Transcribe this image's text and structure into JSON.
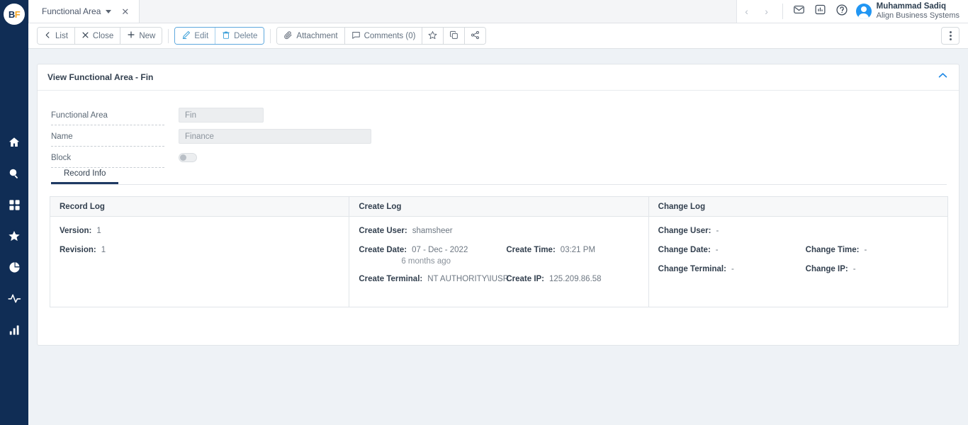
{
  "app": {
    "logo_b": "B",
    "logo_f": "F",
    "background_color": "#eef2f6",
    "sidebar_color": "#102d55",
    "accent_color": "#1f3a63",
    "link_blue": "#2196f3"
  },
  "sidebar": {
    "items": [
      {
        "name": "home-icon",
        "label": "Home"
      },
      {
        "name": "search-icon",
        "label": "Search"
      },
      {
        "name": "grid-icon",
        "label": "Apps"
      },
      {
        "name": "star-icon",
        "label": "Favorites"
      },
      {
        "name": "pie-chart-icon",
        "label": "Reports"
      },
      {
        "name": "activity-icon",
        "label": "Activity"
      },
      {
        "name": "bar-chart-icon",
        "label": "Analytics"
      }
    ]
  },
  "tabstrip": {
    "tab_label": "Functional Area",
    "tab_close": "✕",
    "nav_prev": "‹",
    "nav_next": "›",
    "icons": [
      {
        "name": "mail-icon"
      },
      {
        "name": "chart-icon"
      },
      {
        "name": "help-icon"
      }
    ],
    "user_name": "Muhammad Sadiq",
    "user_org": "Align Business Systems"
  },
  "toolbar": {
    "group_nav": [
      {
        "label": "List",
        "icon": "chevron-left-icon"
      },
      {
        "label": "Close",
        "icon": "close-icon"
      },
      {
        "label": "New",
        "icon": "plus-icon"
      }
    ],
    "group_edit": [
      {
        "label": "Edit",
        "icon": "pencil-icon"
      },
      {
        "label": "Delete",
        "icon": "trash-icon"
      }
    ],
    "group_misc": [
      {
        "label": "Attachment",
        "icon": "paperclip-icon"
      },
      {
        "label": "Comments (0)",
        "icon": "comment-icon"
      }
    ],
    "group_icons": [
      {
        "name": "star-icon"
      },
      {
        "name": "copy-icon"
      },
      {
        "name": "share-icon"
      }
    ],
    "kebab": "more-options"
  },
  "panel": {
    "title": "View Functional Area - Fin",
    "collapse_icon": "chevron-up-icon",
    "fields": [
      {
        "label": "Functional Area",
        "value": "Fin",
        "type": "text"
      },
      {
        "label": "Name",
        "value": "Finance",
        "type": "text"
      },
      {
        "label": "Block",
        "value": "off",
        "type": "toggle"
      }
    ]
  },
  "tabs": [
    {
      "label": "Record Info",
      "active": true
    }
  ],
  "logs": {
    "record_log": {
      "header": "Record Log",
      "rows": [
        {
          "key": "Version:",
          "value": "1"
        },
        {
          "key": "Revision:",
          "value": "1"
        }
      ]
    },
    "create_log": {
      "header": "Create Log",
      "user_key": "Create User:",
      "user_value": "shamsheer",
      "date_key": "Create Date:",
      "date_value": "07 - Dec - 2022",
      "date_relative": "6 months ago",
      "time_key": "Create Time:",
      "time_value": "03:21 PM",
      "terminal_key": "Create Terminal:",
      "terminal_value": "NT AUTHORITY\\IUSR",
      "ip_key": "Create IP:",
      "ip_value": "125.209.86.58"
    },
    "change_log": {
      "header": "Change Log",
      "user_key": "Change User:",
      "user_value": "-",
      "date_key": "Change Date:",
      "date_value": "-",
      "time_key": "Change Time:",
      "time_value": "-",
      "terminal_key": "Change Terminal:",
      "terminal_value": "-",
      "ip_key": "Change IP:",
      "ip_value": "-"
    }
  }
}
